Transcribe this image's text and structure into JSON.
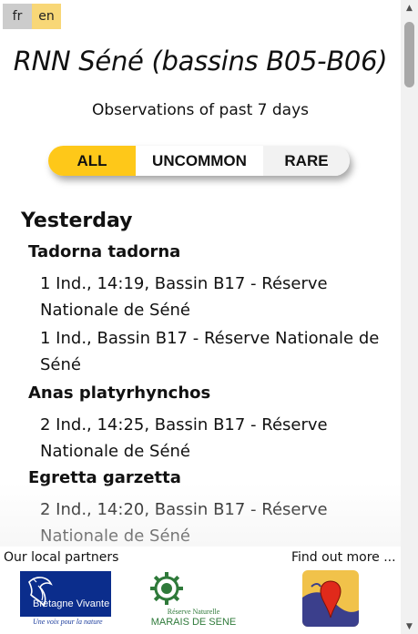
{
  "languages": {
    "fr": "fr",
    "en": "en"
  },
  "site_title": "RNN Séné (bassins B05-B06)",
  "subtitle": "Observations of past 7 days",
  "filter": {
    "all": "ALL",
    "uncommon": "UNCOMMON",
    "rare": "RARE",
    "selected": "ALL"
  },
  "day_heading": "Yesterday",
  "species": [
    {
      "name": "Tadorna tadorna",
      "observations": [
        "1 Ind., 14:19, Bassin B17 - Réserve Nationale de Séné",
        "1 Ind., Bassin B17 - Réserve Nationale de Séné"
      ]
    },
    {
      "name": "Anas platyrhynchos",
      "observations": [
        "2 Ind., 14:25, Bassin B17 - Réserve Nationale de Séné"
      ]
    },
    {
      "name": "Egretta garzetta",
      "observations": [
        "2 Ind., 14:20, Bassin B17 - Réserve Nationale de Séné"
      ]
    }
  ],
  "footer": {
    "partners_label": "Our local partners",
    "more_label": "Find out more ...",
    "bv_name": "Bretagne Vivante",
    "bv_tagline": "Une voix pour la nature",
    "rn_line1": "Réserve Naturelle",
    "rn_line2": "MARAIS DE SENE"
  },
  "colors": {
    "accent": "#fec819",
    "lang_selected": "#f8d777",
    "partner_blue": "#0b2d8c",
    "partner_green": "#2f7a3a"
  },
  "icons": {
    "scroll_up": "triangle-up-icon",
    "scroll_down": "triangle-down-icon",
    "app": "map-pin-icon"
  }
}
